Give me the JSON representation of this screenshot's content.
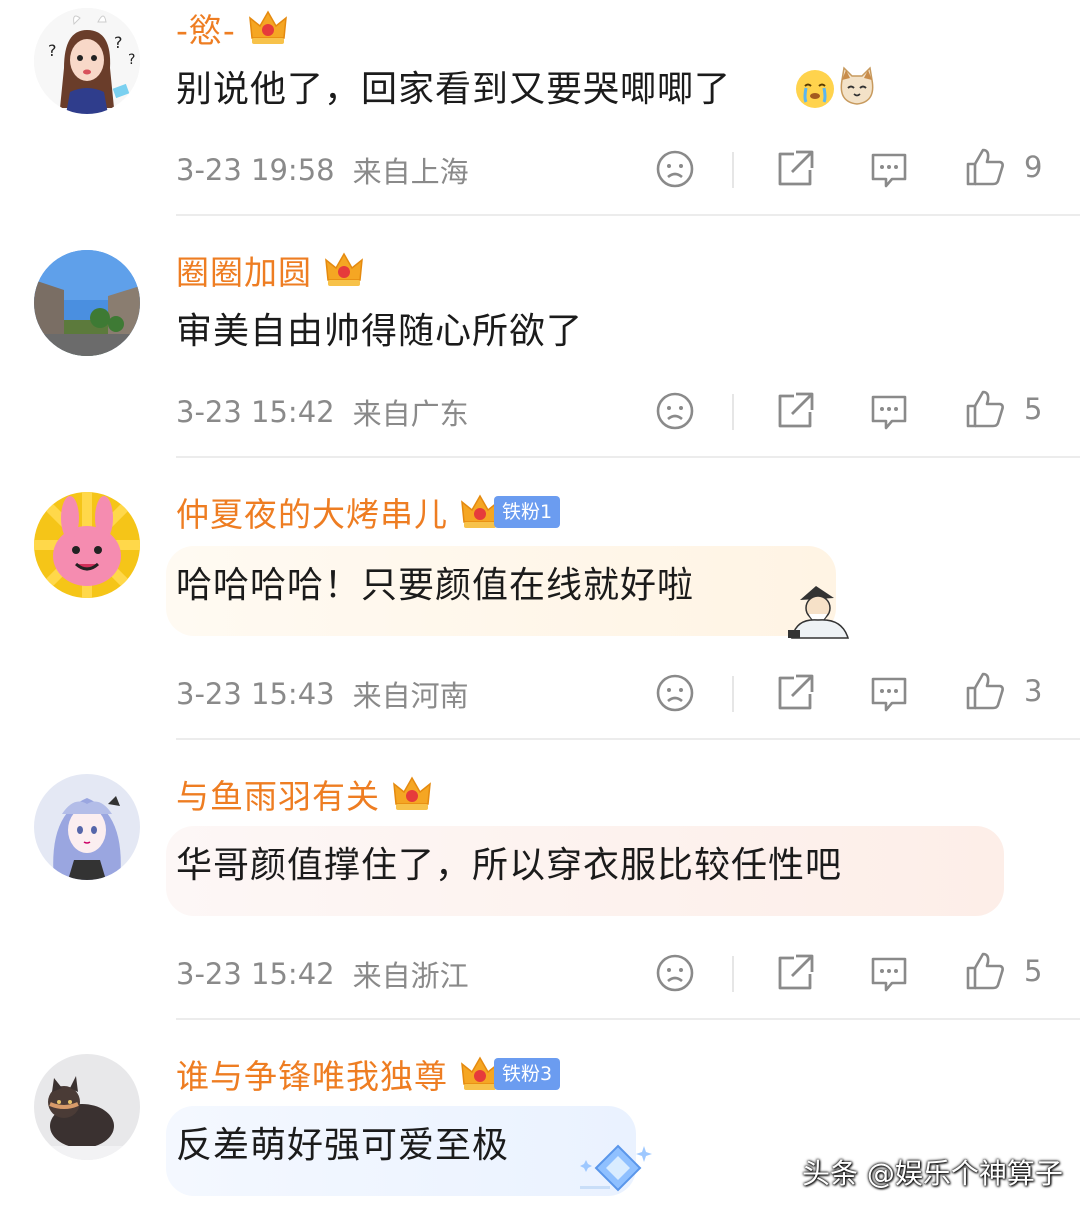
{
  "comments": [
    {
      "username": "-慾-",
      "body": "别说他了，回家看到又要哭唧唧了",
      "time": "3-23 19:58",
      "location": "来自上海",
      "likes": "9",
      "fan_badge": ""
    },
    {
      "username": "圈圈加圆",
      "body": "审美自由帅得随心所欲了",
      "time": "3-23 15:42",
      "location": "来自广东",
      "likes": "5",
      "fan_badge": ""
    },
    {
      "username": "仲夏夜的大烤串儿",
      "body": "哈哈哈哈！只要颜值在线就好啦",
      "time": "3-23 15:43",
      "location": "来自河南",
      "likes": "3",
      "fan_badge": "铁粉1"
    },
    {
      "username": "与鱼雨羽有关",
      "body": "华哥颜值撑住了，所以穿衣服比较任性吧",
      "time": "3-23 15:42",
      "location": "来自浙江",
      "likes": "5",
      "fan_badge": ""
    },
    {
      "username": "谁与争锋唯我独尊",
      "body": "反差萌好强可爱至极",
      "time": "",
      "location": "",
      "likes": "",
      "fan_badge": "铁粉3"
    }
  ],
  "watermark": "头条 @娱乐个神算子",
  "colors": {
    "username": "#ee7d22",
    "meta": "#8a8a8a",
    "fan_badge": "#6b9cf0",
    "divider": "#ececec"
  },
  "icons": [
    "dislike-icon",
    "share-icon",
    "comment-icon",
    "like-icon",
    "crown-icon"
  ]
}
